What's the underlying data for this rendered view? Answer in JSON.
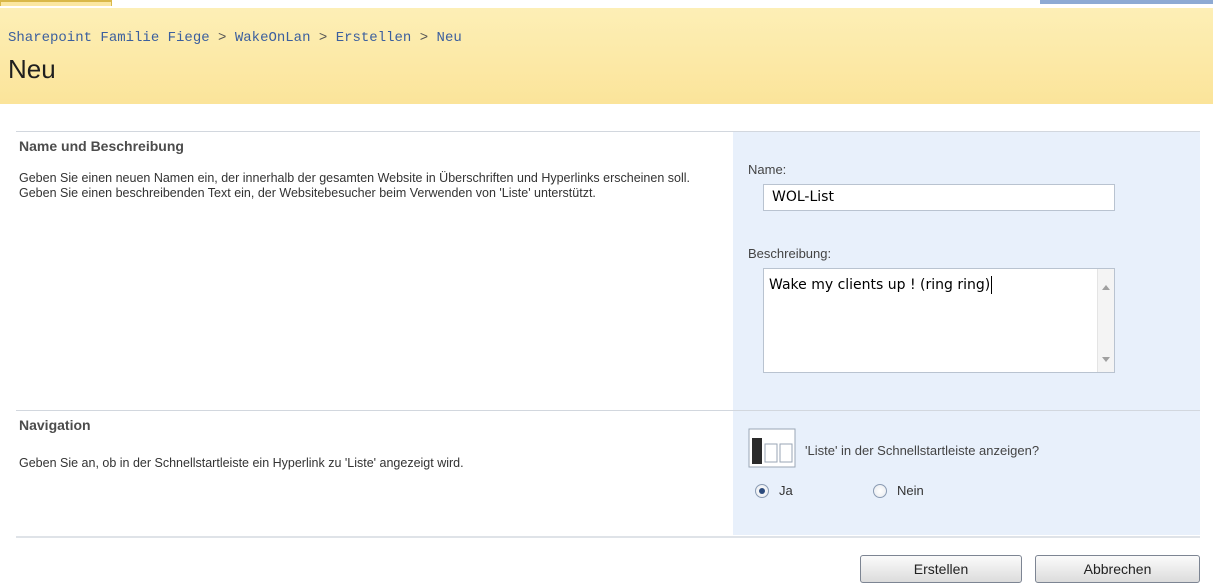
{
  "breadcrumb": {
    "items": [
      "Sharepoint Familie Fiege",
      "WakeOnLan",
      "Erstellen",
      "Neu"
    ],
    "separator": ">"
  },
  "page": {
    "title": "Neu"
  },
  "section_name": {
    "title": "Name und Beschreibung",
    "description": "Geben Sie einen neuen Namen ein, der innerhalb der gesamten Website in Überschriften und Hyperlinks erscheinen soll. Geben Sie einen beschreibenden Text ein, der Websitebesucher beim Verwenden von 'Liste' unterstützt.",
    "name_label": "Name:",
    "name_value": "WOL-List",
    "description_label": "Beschreibung:",
    "description_value": "Wake my clients up ! (ring ring)"
  },
  "section_navigation": {
    "title": "Navigation",
    "description": "Geben Sie an, ob in der Schnellstartleiste ein Hyperlink zu 'Liste' angezeigt wird.",
    "question": "'Liste' in der Schnellstartleiste anzeigen?",
    "option_yes": "Ja",
    "option_no": "Nein",
    "selected": "Ja",
    "icon": "quicklaunch-icon"
  },
  "buttons": {
    "create": "Erstellen",
    "cancel": "Abbrechen"
  },
  "colors": {
    "header_bg": "#fbe49a",
    "panel_bg": "#e8f0fb",
    "link": "#3b5f9e"
  }
}
